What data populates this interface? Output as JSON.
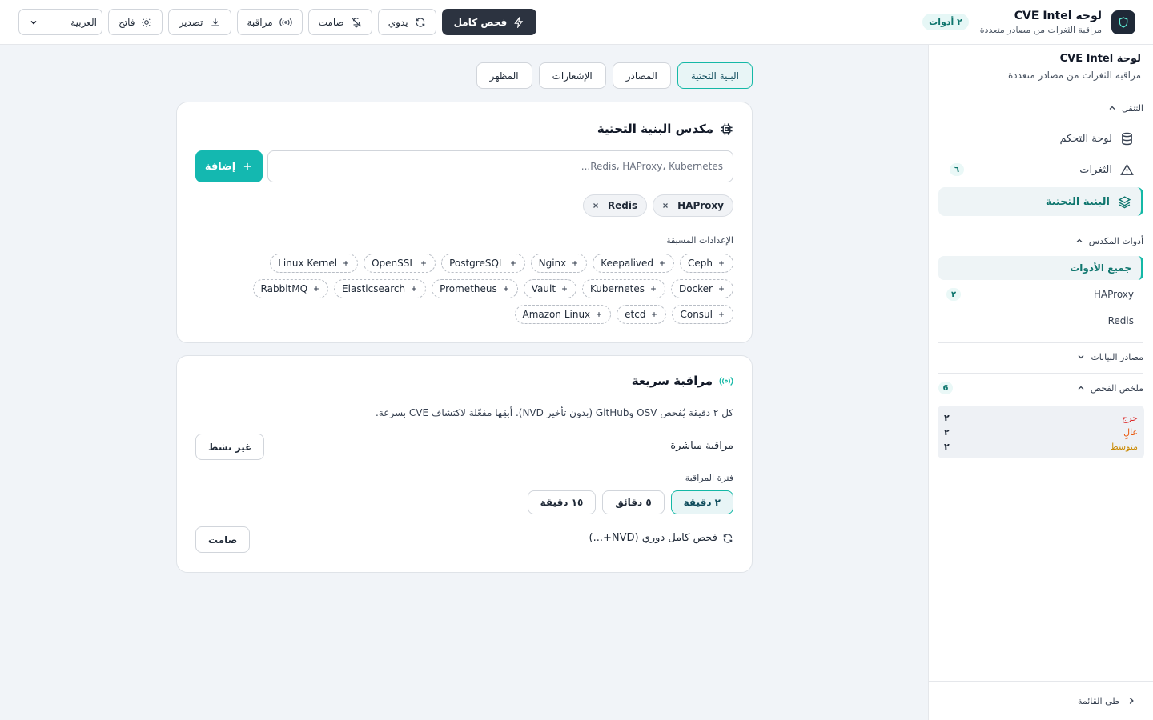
{
  "header": {
    "title": "لوحة CVE Intel",
    "subtitle": "مراقبة الثغرات من مصادر متعددة",
    "tools_badge": "٢ أدوات",
    "language": "العربية",
    "actions": {
      "theme": "فاتح",
      "export": "تصدير",
      "monitor": "مراقبة",
      "silent": "صامت",
      "manual": "يدوي",
      "full_scan": "فحص كامل"
    }
  },
  "sidebar": {
    "title": "لوحة CVE Intel",
    "subtitle": "مراقبة الثغرات من مصادر متعددة",
    "nav_section": "التنقل",
    "nav": {
      "dashboard": "لوحة التحكم",
      "vulns": "الثغرات",
      "vulns_count": "٦",
      "infra": "البنية التحتية"
    },
    "tools_section": "أدوات المكدس",
    "tools": {
      "all": "جميع الأدوات",
      "haproxy": "HAProxy",
      "haproxy_count": "٢",
      "redis": "Redis"
    },
    "data_sources": "مصادر البيانات",
    "scan_summary": "ملخص الفحص",
    "scan_count": "6",
    "summary": [
      {
        "label": "حرج",
        "value": "٢",
        "color": "#dc2626"
      },
      {
        "label": "عالٍ",
        "value": "٢",
        "color": "#ea580c"
      },
      {
        "label": "متوسط",
        "value": "٢",
        "color": "#ca8a04"
      }
    ],
    "collapse": "طي القائمة"
  },
  "tabs": [
    "البنية التحتية",
    "المصادر",
    "الإشعارات",
    "المظهر"
  ],
  "stack_card": {
    "title": "مكدس البنية التحتية",
    "input_placeholder": "Redis، HAProxy، Kubernetes...",
    "add_label": "إضافة",
    "chips": [
      "HAProxy",
      "Redis"
    ],
    "presets_label": "الإعدادات المسبقة",
    "presets": [
      "Ceph",
      "Keepalived",
      "Nginx",
      "PostgreSQL",
      "OpenSSL",
      "Linux Kernel",
      "Docker",
      "Kubernetes",
      "Vault",
      "Prometheus",
      "Elasticsearch",
      "RabbitMQ",
      "Consul",
      "etcd",
      "Amazon Linux"
    ]
  },
  "monitor_card": {
    "title": "مراقبة سريعة",
    "description": "كل ٢ دقيقة يُفحص OSV وGitHub (بدون تأخير NVD). أبقِها مفعّلة لاكتشاف CVE بسرعة.",
    "live_label": "مراقبة مباشرة",
    "live_status": "غير نشط",
    "interval_label": "فترة المراقبة",
    "intervals": [
      "٢ دقيقة",
      "٥ دقائق",
      "١٥ دقيقة"
    ],
    "periodic_label": "فحص كامل دوري (NVD+...)",
    "periodic_status": "صامت"
  },
  "colors": {
    "accent": "#14b8b0",
    "primary_dark": "#2c3340",
    "active_bg": "#e8f5f6"
  }
}
